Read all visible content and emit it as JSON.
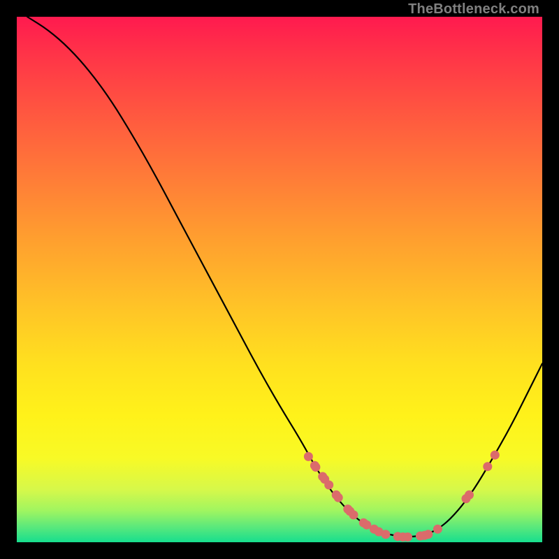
{
  "watermark": "TheBottleneck.com",
  "colors": {
    "dot": "#db6b6b",
    "curve": "#000000",
    "gradient_top": "#ff1a4f",
    "gradient_bottom": "#17de8e"
  },
  "chart_data": {
    "type": "line",
    "title": "",
    "xlabel": "",
    "ylabel": "",
    "xlim": [
      0,
      100
    ],
    "ylim": [
      0,
      100
    ],
    "note": "Axes are unlabelled in the image; coordinates are percentage positions within the plot area. y = 100 is the top edge, y = 0 the bottom.",
    "series": [
      {
        "name": "curve",
        "kind": "line",
        "x": [
          2,
          6,
          10,
          14,
          18,
          22,
          26,
          30,
          34,
          38,
          42,
          46,
          50,
          54,
          57,
          60,
          63,
          66,
          69,
          72,
          75,
          78,
          81,
          84,
          87,
          90,
          94,
          98,
          100
        ],
        "y": [
          100,
          97.5,
          94,
          89.5,
          84,
          77.5,
          70.5,
          63,
          55.5,
          48,
          40.5,
          33,
          26,
          19.5,
          14,
          9.5,
          6,
          3.5,
          2,
          1.2,
          1,
          1.4,
          3,
          6,
          10,
          15,
          22,
          30,
          34
        ]
      },
      {
        "name": "points",
        "kind": "scatter",
        "x": [
          55.5,
          56.7,
          56.9,
          58.2,
          58.6,
          59.4,
          60.8,
          61.2,
          63.0,
          63.4,
          64.1,
          66.0,
          66.6,
          68.0,
          68.9,
          70.2,
          72.5,
          73.5,
          74.4,
          76.8,
          77.6,
          78.3,
          80.1,
          85.5,
          86.1,
          89.6,
          91.0
        ],
        "y": [
          16.3,
          14.6,
          14.3,
          12.5,
          12.0,
          10.9,
          9.0,
          8.5,
          6.3,
          5.9,
          5.2,
          3.7,
          3.3,
          2.5,
          2.0,
          1.5,
          1.1,
          1.0,
          1.0,
          1.2,
          1.3,
          1.5,
          2.5,
          8.3,
          9.0,
          14.4,
          16.6
        ]
      }
    ]
  }
}
